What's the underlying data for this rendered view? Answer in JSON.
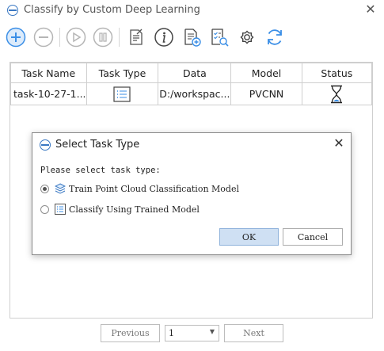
{
  "window": {
    "title": "Classify by Custom Deep Learning",
    "close_glyph": "✕"
  },
  "toolbar": {
    "buttons": [
      {
        "name": "add-task-icon"
      },
      {
        "name": "remove-task-icon"
      },
      {
        "name": "start-icon"
      },
      {
        "name": "pause-icon"
      },
      {
        "name": "log-icon"
      },
      {
        "name": "info-icon"
      },
      {
        "name": "import-icon"
      },
      {
        "name": "task-list-search-icon"
      },
      {
        "name": "settings-icon"
      },
      {
        "name": "refresh-icon"
      }
    ],
    "accent_color": "#3a8ee6",
    "disabled_color": "#b5b5b5"
  },
  "table": {
    "columns": [
      "Task Name",
      "Task Type",
      "Data",
      "Model",
      "Status"
    ],
    "rows": [
      {
        "task_name": "task-10-27-1...",
        "task_type_icon": "list-icon",
        "data": "D:/workspac...",
        "model": "PVCNN",
        "status_icon": "hourglass-icon"
      }
    ]
  },
  "pager": {
    "previous": "Previous",
    "page": "1",
    "next": "Next"
  },
  "dialog": {
    "title": "Select Task Type",
    "close_glyph": "✕",
    "prompt": "Please select task type:",
    "options": [
      {
        "label": "Train Point Cloud Classification Model",
        "selected": true,
        "icon": "layers-icon"
      },
      {
        "label": "Classify Using Trained Model",
        "selected": false,
        "icon": "list-icon"
      }
    ],
    "ok": "OK",
    "cancel": "Cancel"
  }
}
